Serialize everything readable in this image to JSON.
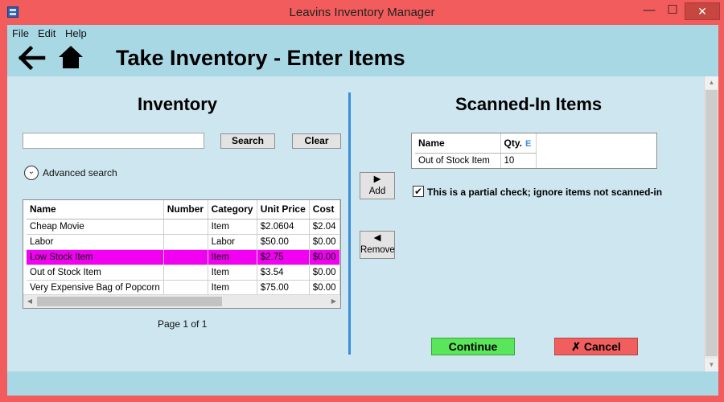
{
  "window": {
    "title": "Leavins Inventory Manager",
    "min_glyph": "—",
    "max_glyph": "☐",
    "close_glyph": "✕"
  },
  "menu": {
    "file": "File",
    "edit": "Edit",
    "help": "Help"
  },
  "page": {
    "title": "Take Inventory - Enter Items"
  },
  "inventory": {
    "title": "Inventory",
    "search_value": "",
    "search_button": "Search",
    "clear_button": "Clear",
    "advanced_search": "Advanced search",
    "columns": [
      "Name",
      "Number",
      "Category",
      "Unit Price",
      "Cost"
    ],
    "rows": [
      {
        "name": "Cheap Movie",
        "number": "",
        "category": "Item",
        "unit_price": "$2.0604",
        "cost": "$2.04",
        "highlighted": false
      },
      {
        "name": "Labor",
        "number": "",
        "category": "Labor",
        "unit_price": "$50.00",
        "cost": "$0.00",
        "highlighted": false
      },
      {
        "name": "Low Stock Item",
        "number": "",
        "category": "Item",
        "unit_price": "$2.75",
        "cost": "$0.00",
        "highlighted": true
      },
      {
        "name": "Out of Stock Item",
        "number": "",
        "category": "Item",
        "unit_price": "$3.54",
        "cost": "$0.00",
        "highlighted": false
      },
      {
        "name": "Very Expensive Bag of Popcorn",
        "number": "",
        "category": "Item",
        "unit_price": "$75.00",
        "cost": "$0.00",
        "highlighted": false
      }
    ],
    "page_info": "Page 1 of 1"
  },
  "transfer": {
    "add_glyph": "▶",
    "add_label": "Add",
    "remove_glyph": "◀",
    "remove_label": "Remove"
  },
  "scanned": {
    "title": "Scanned-In Items",
    "columns": [
      "Name",
      "Qty."
    ],
    "qty_marker": "E",
    "rows": [
      {
        "name": "Out of Stock Item",
        "qty": "10"
      }
    ],
    "partial_check_checked": true,
    "partial_check_label": "This is a partial check; ignore items not scanned-in"
  },
  "actions": {
    "continue_label": "Continue",
    "cancel_label": "✗ Cancel"
  },
  "colors": {
    "window_frame": "#f25c5c",
    "client_bg": "#a9d8e5",
    "content_bg": "#cde6ef",
    "highlight_row": "#f200f2",
    "divider": "#3a8ddc",
    "continue_bg": "#5ae65a",
    "cancel_bg": "#f05e5e"
  }
}
